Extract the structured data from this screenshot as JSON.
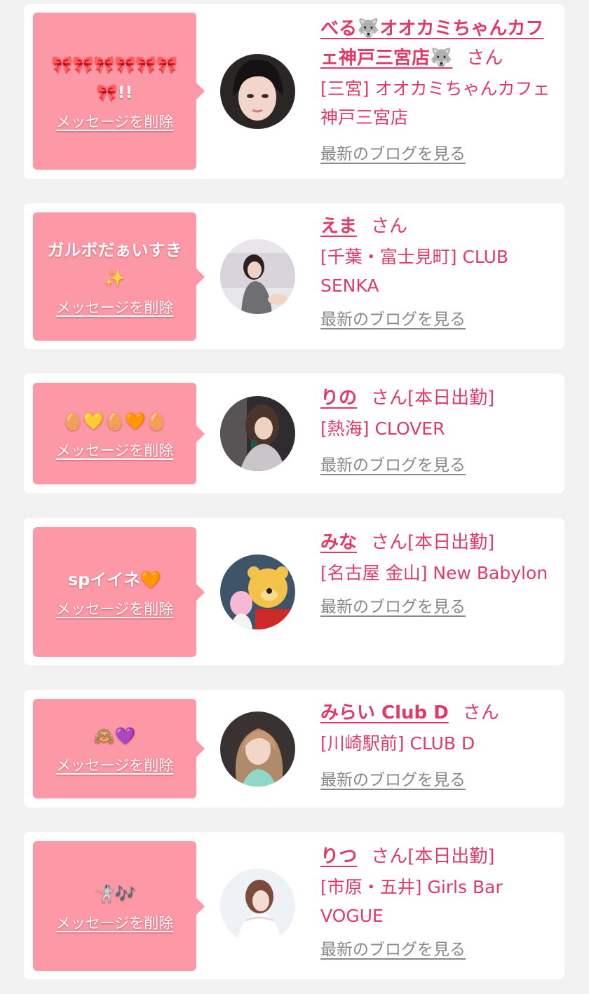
{
  "items": [
    {
      "message": "🎀🎀🎀🎀🎀🎀🎀!!",
      "delete_label": "メッセージを削除",
      "name": "べる🐺オオカミちゃんカフェ神戸三宮店🐺",
      "honorific": "さん",
      "status": "",
      "shop": "[三宮] オオカミちゃんカフェ神戸三宮店",
      "blog_label": "最新のブログを見る"
    },
    {
      "message": "ガルボだぁいすき✨",
      "delete_label": "メッセージを削除",
      "name": "えま",
      "honorific": "さん",
      "status": "",
      "shop": "[千葉・富士見町] CLUB SENKA",
      "blog_label": "最新のブログを見る"
    },
    {
      "message": "🥚💛🥚🧡🥚",
      "delete_label": "メッセージを削除",
      "name": "りの",
      "honorific": "さん",
      "status": "[本日出勤]",
      "shop": "[熱海] CLOVER",
      "blog_label": "最新のブログを見る"
    },
    {
      "message": "spイイネ🧡",
      "delete_label": "メッセージを削除",
      "name": "みな",
      "honorific": "さん",
      "status": "[本日出勤]",
      "shop": "[名古屋 金山] New Babylon",
      "blog_label": "最新のブログを見る"
    },
    {
      "message": "🙈💜",
      "delete_label": "メッセージを削除",
      "name": "みらい Club D",
      "honorific": "さん",
      "status": "",
      "shop": "[川崎駅前] CLUB D",
      "blog_label": "最新のブログを見る"
    },
    {
      "message": "🤺🎶",
      "delete_label": "メッセージを削除",
      "name": "りつ",
      "honorific": "さん",
      "status": "[本日出勤]",
      "shop": "[市原・五井] Girls Bar VOGUE",
      "blog_label": "最新のブログを見る"
    }
  ],
  "colors": {
    "page_background": "#f2f2f2",
    "card_background": "#ffffff",
    "bubble": "#fd98a6",
    "name_pink": "#e23a66",
    "blog_gray": "#888888"
  }
}
